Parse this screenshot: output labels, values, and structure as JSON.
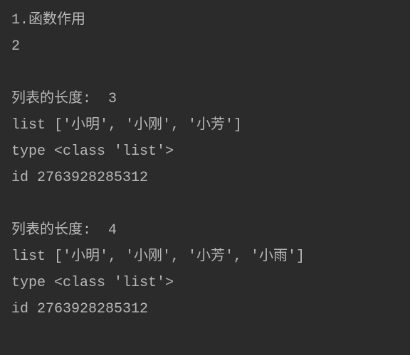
{
  "lines": {
    "l1": "1.函数作用",
    "l2": "2",
    "l3": "",
    "l4": "列表的长度:  3",
    "l5": "list ['小明', '小刚', '小芳']",
    "l6": "type <class 'list'>",
    "l7": "id 2763928285312",
    "l8": "",
    "l9": "列表的长度:  4",
    "l10": "list ['小明', '小刚', '小芳', '小雨']",
    "l11": "type <class 'list'>",
    "l12": "id 2763928285312"
  }
}
